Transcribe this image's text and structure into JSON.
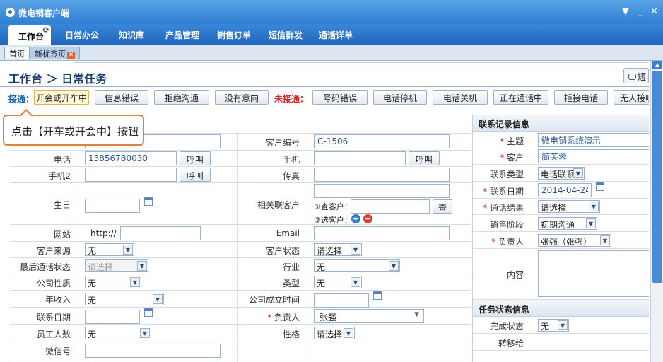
{
  "window": {
    "title": "微电销客户端",
    "controls": [
      "▼",
      "_",
      "✕"
    ]
  },
  "menu": [
    "工作台",
    "日常办公",
    "知识库",
    "产品管理",
    "销售订单",
    "短信群发",
    "通话详单"
  ],
  "tabs": [
    "首页",
    "新标签页"
  ],
  "breadcrumb": "工作台 ＞ 日常任务",
  "sms_label": "短",
  "status": {
    "connected_label": "接通：",
    "connected": [
      "开会或开车中",
      "信息错误",
      "拒绝沟通",
      "没有意向"
    ],
    "unconnected_label": "未接通：",
    "unconnected": [
      "号码错误",
      "电话停机",
      "电话关机",
      "正在通话中",
      "拒接电话",
      "无人接听"
    ]
  },
  "tooltip": "点击【开车或开会中】按钮",
  "form": {
    "customer_no_label": "客户编号",
    "customer_no": "C-1506",
    "phone_label": "电话",
    "phone": "13856780030",
    "call_label": "呼叫",
    "mobile_label": "手机",
    "mobile2_label": "手机2",
    "fax_label": "传真",
    "birthday_label": "生日",
    "related_label": "相关联客户",
    "search_customer_label": "①查客户：",
    "search_button": "查",
    "select_customer_label": "②选客户：",
    "website_label": "网站",
    "website_prefix": "http://",
    "email_label": "Email",
    "source_label": "客户来源",
    "source": "无",
    "cust_status_label": "客户状态",
    "cust_status": "请选择",
    "last_call_label": "最后通话状态",
    "last_call": "请选择",
    "industry_label": "行业",
    "industry": "无",
    "company_type_label": "公司性质",
    "company_type": "无",
    "category_label": "类型",
    "category": "无",
    "income_label": "年收入",
    "income": "无",
    "founded_label": "公司成立时间",
    "contact_date_label": "联系日期",
    "owner_label": "负责人",
    "owner": "张强",
    "employees_label": "员工人数",
    "employees": "无",
    "personality_label": "性格",
    "personality": "请选择",
    "wechat_label": "微信号"
  },
  "contact": {
    "header": "联系记录信息",
    "subject_label": "主题",
    "subject": "微电销系统演示",
    "customer_label": "客户",
    "customer": "简芙蓉",
    "type_label": "联系类型",
    "type": "电话联系",
    "date_label": "联系日期",
    "date": "2014-04-24",
    "result_label": "通话结果",
    "result": "请选择",
    "stage_label": "销售阶段",
    "stage": "初期沟通",
    "owner_label": "负责人",
    "owner": "张强（张强）",
    "content_label": "内容"
  },
  "task": {
    "header": "任务状态信息",
    "done_label": "完成状态",
    "done": "无",
    "transfer_label": "转移给"
  },
  "colors": {
    "titlebar": "#2f7fd2",
    "accent_red": "#d22222",
    "tooltip_border": "#e0803a"
  }
}
